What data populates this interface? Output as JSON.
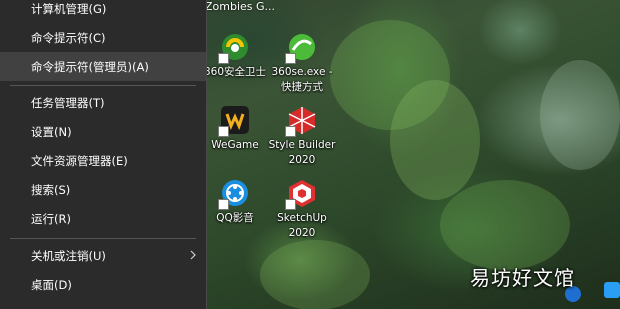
{
  "context_menu": {
    "items": [
      {
        "label": "计算机管理(G)"
      },
      {
        "label": "命令提示符(C)"
      },
      {
        "label": "命令提示符(管理员)(A)"
      },
      {
        "label": "任务管理器(T)"
      },
      {
        "label": "设置(N)"
      },
      {
        "label": "文件资源管理器(E)"
      },
      {
        "label": "搜索(S)"
      },
      {
        "label": "运行(R)"
      },
      {
        "label": "关机或注销(U)"
      },
      {
        "label": "桌面(D)"
      }
    ],
    "highlighted_item": "命令提示符(管理员)(A)"
  },
  "desktop": {
    "top_partial_label": "Zombies G...",
    "icons": [
      {
        "label": "360安全卫士",
        "icon": "360-security-icon"
      },
      {
        "label": "360se.exe - 快捷方式",
        "icon": "360-browser-icon"
      },
      {
        "label": "WeGame",
        "icon": "wegame-icon"
      },
      {
        "label": "Style Builder 2020",
        "icon": "style-builder-icon"
      },
      {
        "label": "QQ影音",
        "icon": "qq-player-icon"
      },
      {
        "label": "SketchUp 2020",
        "icon": "sketchup-icon"
      }
    ]
  },
  "watermark": "易坊好文馆",
  "colors": {
    "menu_bg": "#2b2b2b",
    "menu_highlight": "#414141",
    "menu_text": "#ffffff"
  }
}
